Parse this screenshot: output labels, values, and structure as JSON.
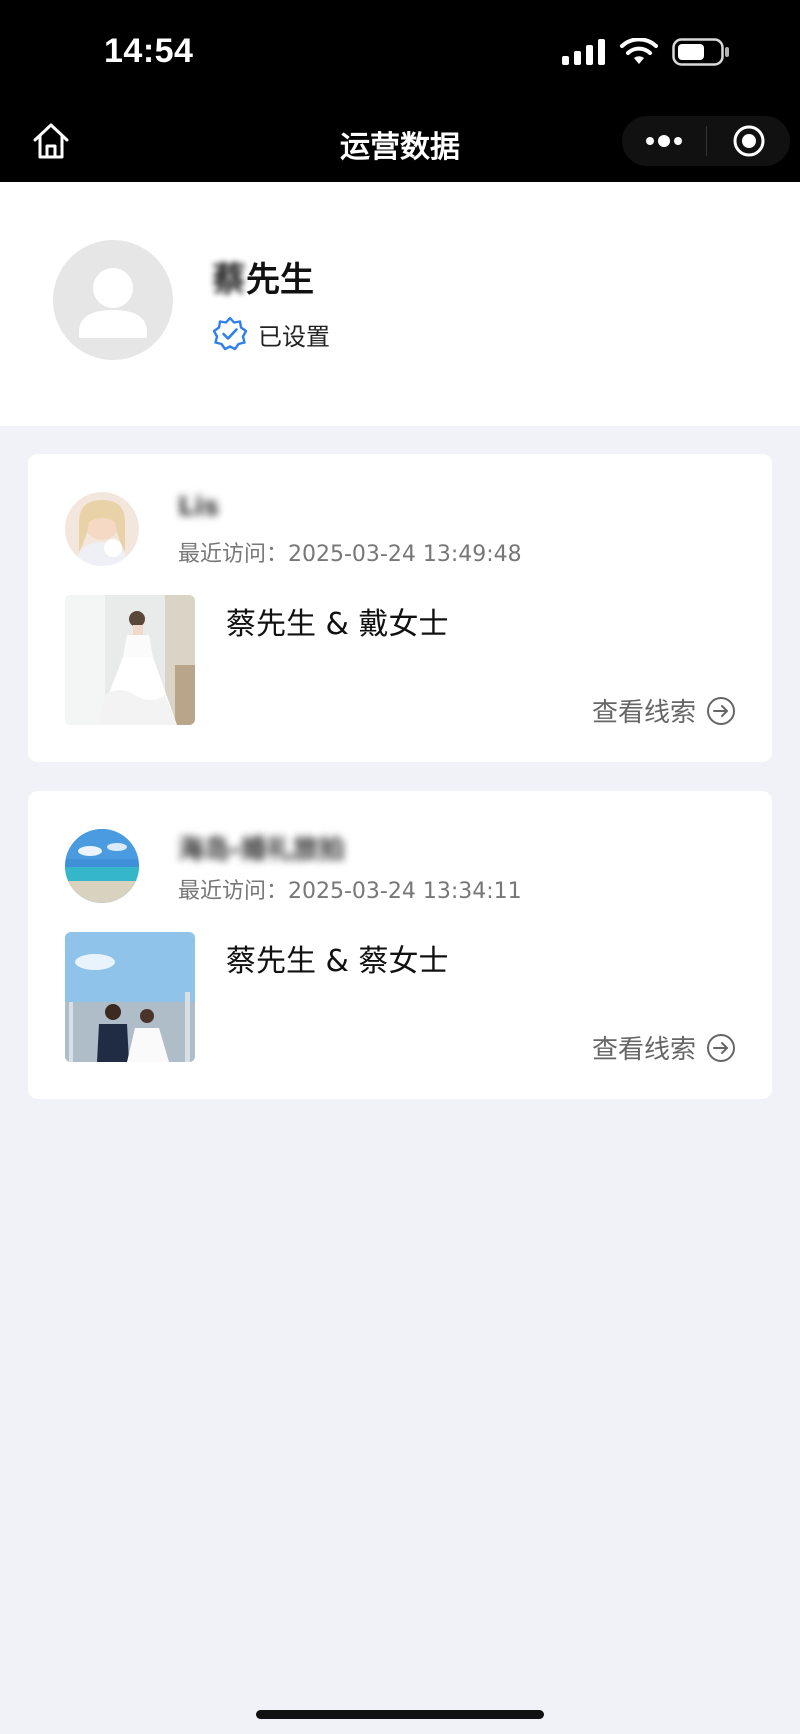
{
  "status_bar": {
    "time": "14:54"
  },
  "nav": {
    "title": "运营数据"
  },
  "profile": {
    "name_blurred": "蔡",
    "name_suffix": "先生",
    "verified_label": "已设置",
    "accent_color": "#2f80ed"
  },
  "cards": [
    {
      "visitor_name": "Lis",
      "visit_time": "最近访问：2025-03-24 13:49:48",
      "couple": "蔡先生 & 戴女士",
      "action": "查看线索"
    },
    {
      "visitor_name": "海岛-婚礼旅拍",
      "visit_time": "最近访问：2025-03-24 13:34:11",
      "couple": "蔡先生 & 蔡女士",
      "action": "查看线索"
    }
  ]
}
